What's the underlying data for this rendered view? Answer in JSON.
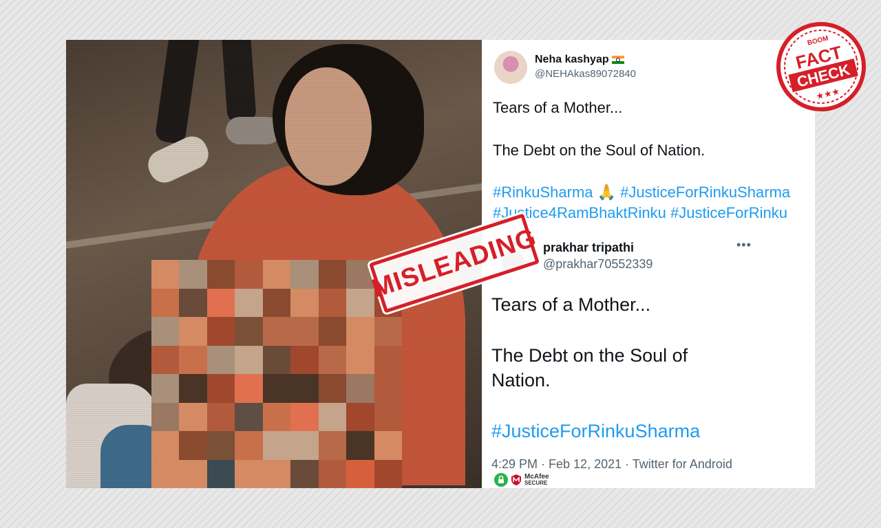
{
  "stamp": {
    "text": "MISLEADING",
    "color": "#d61f28"
  },
  "seal": {
    "brand": "BOOM",
    "line1": "FACT",
    "line2": "CHECK",
    "stars": "★★★",
    "color": "#d61f28"
  },
  "tweet1": {
    "name": "Neha kashyap",
    "handle": "@NEHAkas89072840",
    "line1": "Tears of a Mother...",
    "line2": "The Debt on the Soul of Nation.",
    "tag1": "#RinkuSharma",
    "emoji": "🙏",
    "tag2": "#JusticeForRinkuSharma",
    "tag3": "#Justice4RamBhaktRinku",
    "tag4": "#JusticeForRinku"
  },
  "tweet2": {
    "name": "prakhar tripathi",
    "handle": "@prakhar70552339",
    "more_icon": "more-horizontal-icon",
    "line1": "Tears of a Mother...",
    "line2a": "The Debt on the Soul of",
    "line2b": "Nation.",
    "tag": "#JusticeForRinkuSharma",
    "meta": "4:29 PM · Feb 12, 2021 · Twitter for Android"
  },
  "badge": {
    "brand": "McAfee",
    "label": "SECURE",
    "lock_color": "#2bb24c"
  },
  "colors": {
    "hashtag": "#1d9bf0",
    "handle": "#536471",
    "text": "#0f1419"
  }
}
